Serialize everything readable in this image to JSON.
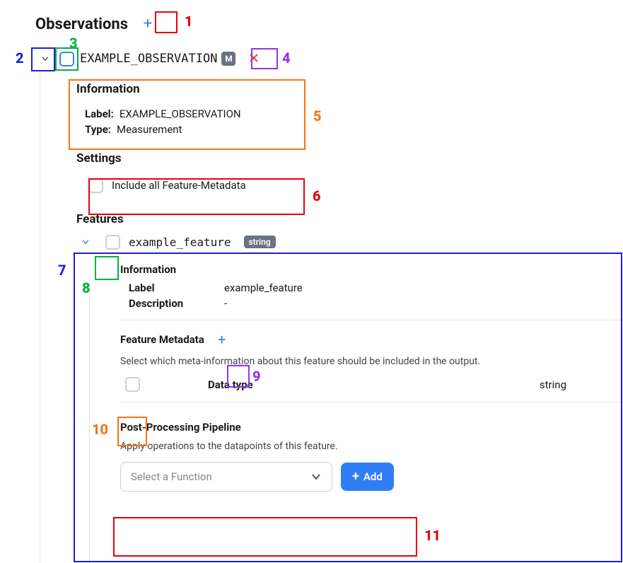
{
  "header": {
    "title": "Observations"
  },
  "observation": {
    "label": "EXAMPLE_OBSERVATION",
    "type_badge": "M",
    "info_title": "Information",
    "info_label_key": "Label:",
    "info_label_value": "EXAMPLE_OBSERVATION",
    "info_type_key": "Type:",
    "info_type_value": "Measurement",
    "settings_title": "Settings",
    "include_all_metadata_label": "Include all Feature-Metadata"
  },
  "features": {
    "section_title": "Features",
    "item": {
      "label": "example_feature",
      "type_badge": "string",
      "info_title": "Information",
      "rows": {
        "label_key": "Label",
        "label_value": "example_feature",
        "description_key": "Description",
        "description_value": "-"
      },
      "metadata": {
        "title": "Feature Metadata",
        "help": "Select which meta-information about this feature should be included in the output.",
        "row_label": "Data type",
        "row_value": "string"
      },
      "pipeline": {
        "title": "Post-Processing Pipeline",
        "help": "Apply operations to the datapoints of this feature.",
        "select_placeholder": "Select a Function",
        "add_label": "Add"
      }
    }
  },
  "annotations": {
    "n1": "1",
    "n2": "2",
    "n3": "3",
    "n4": "4",
    "n5": "5",
    "n6": "6",
    "n7": "7",
    "n8": "8",
    "n9": "9",
    "n10": "10",
    "n11": "11"
  }
}
